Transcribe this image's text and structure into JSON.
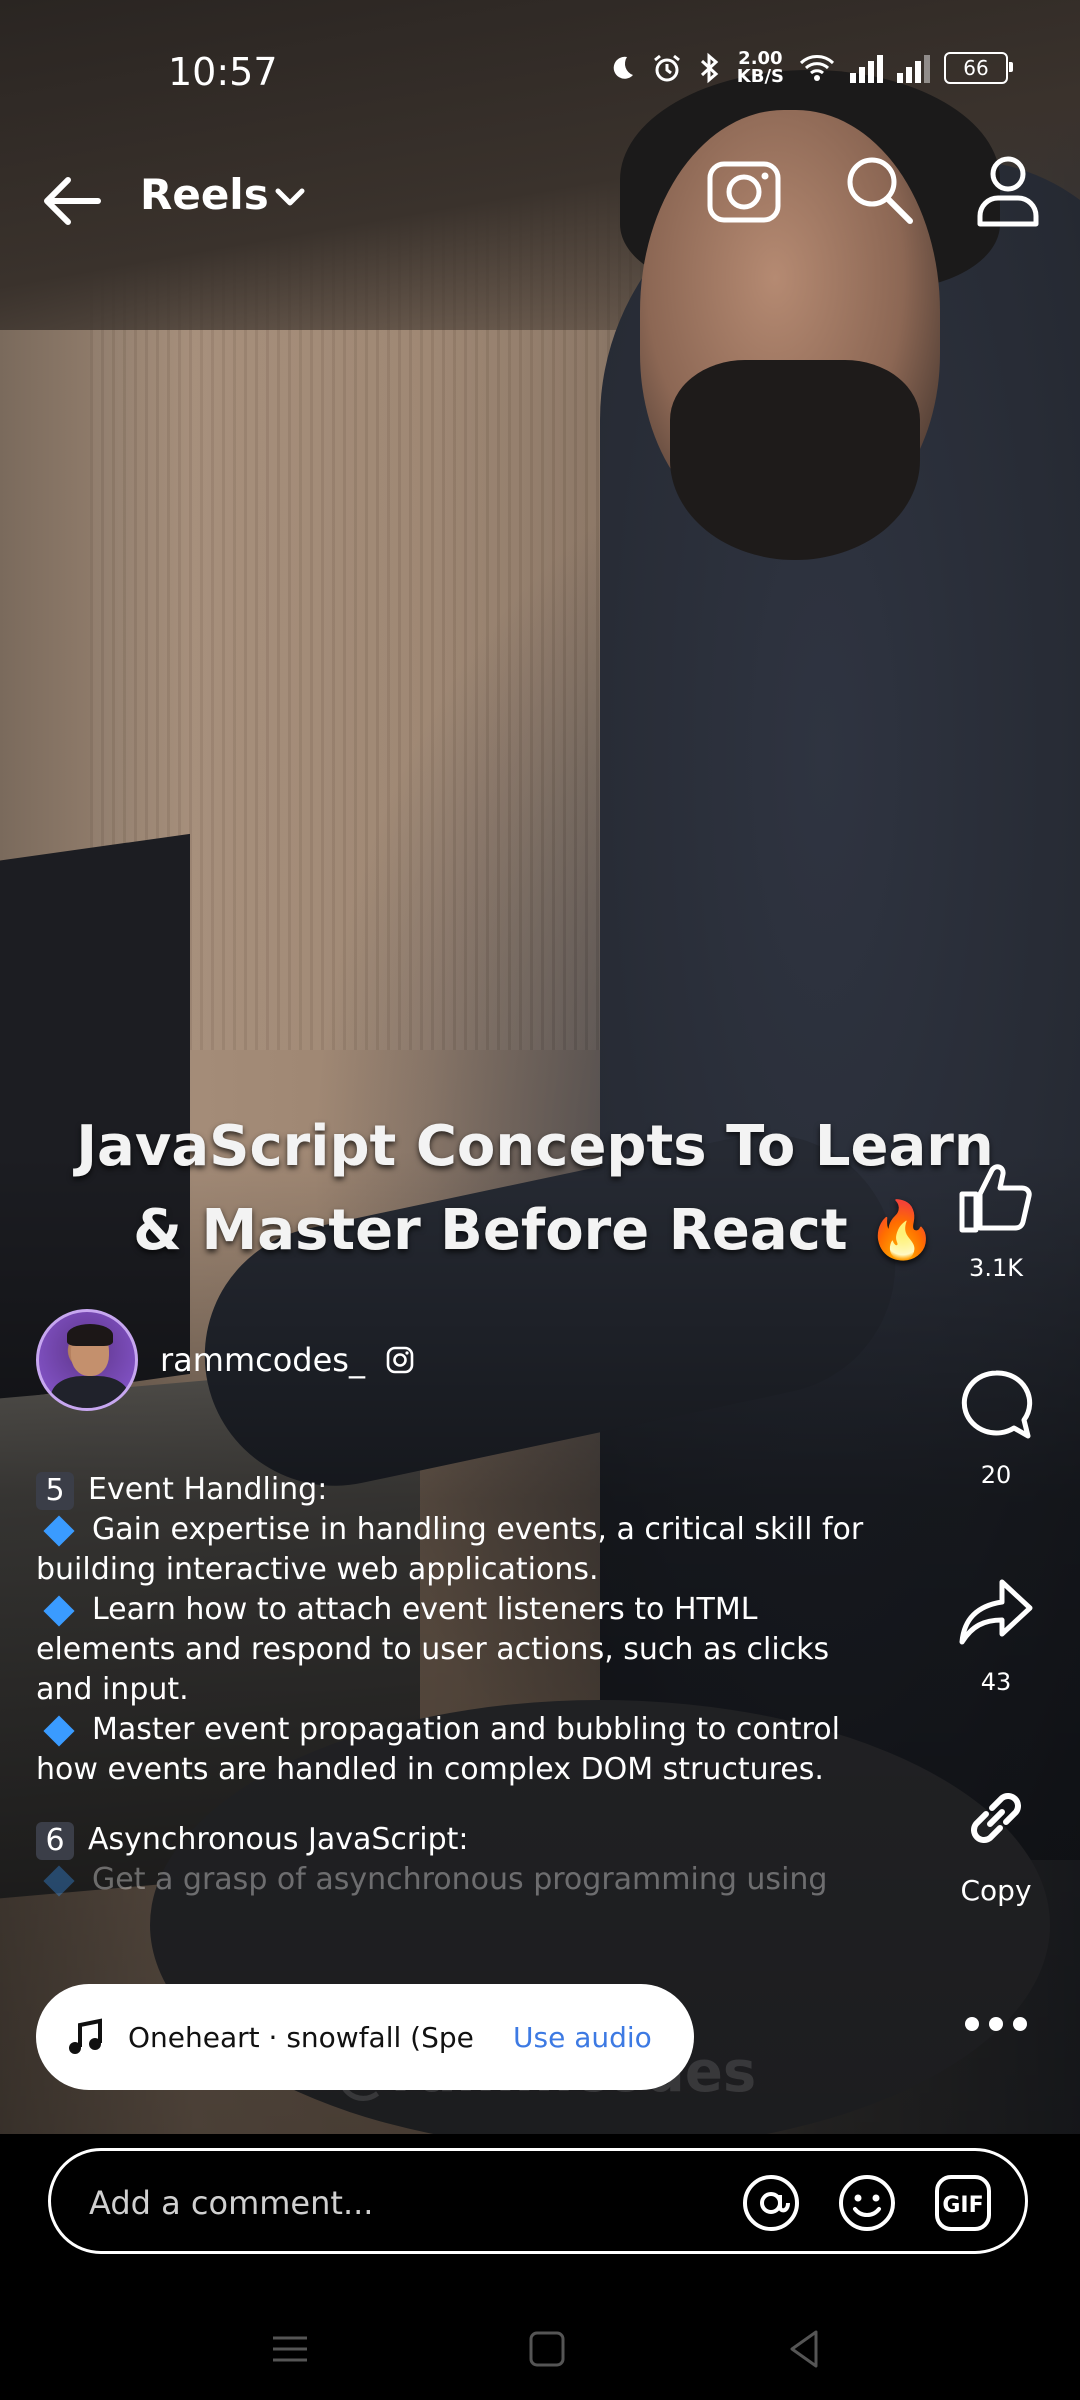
{
  "status_bar": {
    "time": "10:57",
    "net_speed_value": "2.00",
    "net_speed_unit": "KB/S",
    "battery": "66"
  },
  "header": {
    "title": "Reels"
  },
  "video": {
    "overlay_title": "JavaScript Concepts To Learn & Master Before React 🔥",
    "watermark": "@rammcodes"
  },
  "post": {
    "username": "rammcodes_"
  },
  "actions": {
    "likes": "3.1K",
    "comments": "20",
    "shares": "43",
    "copy_label": "Copy"
  },
  "caption": {
    "sections": [
      {
        "num": "5",
        "title": "Event Handling:",
        "points": [
          "Gain expertise in handling events, a critical skill for building interactive web applications.",
          "Learn how to attach event listeners to HTML elements and respond to user actions, such as clicks and input.",
          "Master event propagation and bubbling to control how events are handled in complex DOM structures."
        ]
      },
      {
        "num": "6",
        "title": "Asynchronous JavaScript:",
        "points": [
          "Get a grasp of asynchronous programming using"
        ]
      }
    ]
  },
  "audio": {
    "track": "Oneheart · snowfall (Sped",
    "use_audio_label": "Use audio"
  },
  "comment_box": {
    "placeholder": "Add a comment..."
  },
  "colors": {
    "accent_link": "#3d7ae3",
    "diamond": "#3a9bff"
  }
}
